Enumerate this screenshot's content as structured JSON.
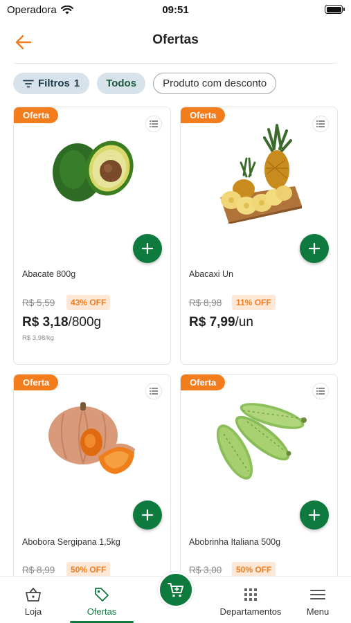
{
  "status_bar": {
    "carrier": "Operadora",
    "time": "09:51"
  },
  "header": {
    "title": "Ofertas"
  },
  "filters": {
    "filter_label": "Filtros",
    "filter_count": "1",
    "todos": "Todos",
    "discount_chip": "Produto com desconto"
  },
  "products": [
    {
      "badge": "Oferta",
      "name": "Abacate 800g",
      "old_price": "R$ 5,59",
      "discount": "43% OFF",
      "price": "R$ 3,18",
      "unit": "/800g",
      "unit_price": "R$ 3,98/kg"
    },
    {
      "badge": "Oferta",
      "name": "Abacaxi Un",
      "old_price": "R$ 8,98",
      "discount": "11% OFF",
      "price": "R$ 7,99",
      "unit": "/un"
    },
    {
      "badge": "Oferta",
      "name": "Abobora Sergipana 1,5kg",
      "old_price": "R$ 8,99",
      "discount": "50% OFF"
    },
    {
      "badge": "Oferta",
      "name": "Abobrinha Italiana 500g",
      "old_price": "R$ 3,00",
      "discount": "50% OFF"
    }
  ],
  "bottom_nav": {
    "items": [
      {
        "label": "Loja",
        "icon": "basket-icon"
      },
      {
        "label": "Ofertas",
        "icon": "tag-icon"
      },
      {
        "label": "Departamentos",
        "icon": "grid-icon"
      },
      {
        "label": "Menu",
        "icon": "hamburger-icon"
      }
    ],
    "active": "Ofertas",
    "cart_icon": "cart-icon"
  },
  "colors": {
    "brand_green": "#0f7a3e",
    "accent_orange": "#f37c1c"
  }
}
